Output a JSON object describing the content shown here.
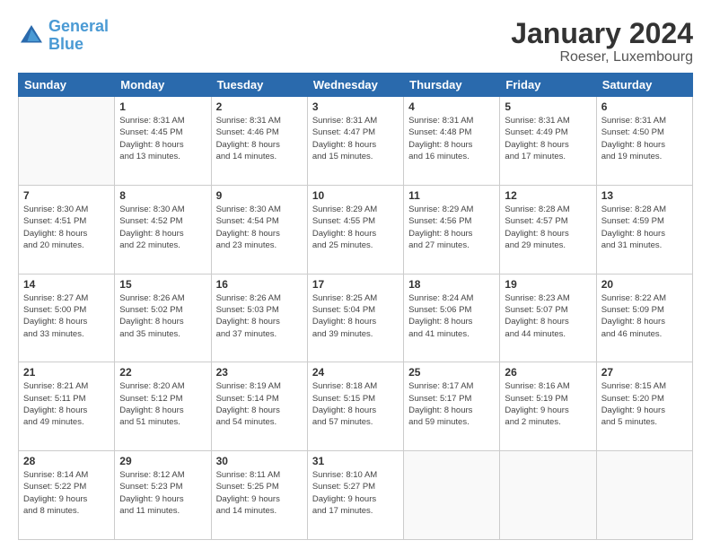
{
  "header": {
    "logo_line1": "General",
    "logo_line2": "Blue",
    "month": "January 2024",
    "location": "Roeser, Luxembourg"
  },
  "days_of_week": [
    "Sunday",
    "Monday",
    "Tuesday",
    "Wednesday",
    "Thursday",
    "Friday",
    "Saturday"
  ],
  "weeks": [
    [
      {
        "day": "",
        "info": ""
      },
      {
        "day": "1",
        "info": "Sunrise: 8:31 AM\nSunset: 4:45 PM\nDaylight: 8 hours\nand 13 minutes."
      },
      {
        "day": "2",
        "info": "Sunrise: 8:31 AM\nSunset: 4:46 PM\nDaylight: 8 hours\nand 14 minutes."
      },
      {
        "day": "3",
        "info": "Sunrise: 8:31 AM\nSunset: 4:47 PM\nDaylight: 8 hours\nand 15 minutes."
      },
      {
        "day": "4",
        "info": "Sunrise: 8:31 AM\nSunset: 4:48 PM\nDaylight: 8 hours\nand 16 minutes."
      },
      {
        "day": "5",
        "info": "Sunrise: 8:31 AM\nSunset: 4:49 PM\nDaylight: 8 hours\nand 17 minutes."
      },
      {
        "day": "6",
        "info": "Sunrise: 8:31 AM\nSunset: 4:50 PM\nDaylight: 8 hours\nand 19 minutes."
      }
    ],
    [
      {
        "day": "7",
        "info": "Sunrise: 8:30 AM\nSunset: 4:51 PM\nDaylight: 8 hours\nand 20 minutes."
      },
      {
        "day": "8",
        "info": "Sunrise: 8:30 AM\nSunset: 4:52 PM\nDaylight: 8 hours\nand 22 minutes."
      },
      {
        "day": "9",
        "info": "Sunrise: 8:30 AM\nSunset: 4:54 PM\nDaylight: 8 hours\nand 23 minutes."
      },
      {
        "day": "10",
        "info": "Sunrise: 8:29 AM\nSunset: 4:55 PM\nDaylight: 8 hours\nand 25 minutes."
      },
      {
        "day": "11",
        "info": "Sunrise: 8:29 AM\nSunset: 4:56 PM\nDaylight: 8 hours\nand 27 minutes."
      },
      {
        "day": "12",
        "info": "Sunrise: 8:28 AM\nSunset: 4:57 PM\nDaylight: 8 hours\nand 29 minutes."
      },
      {
        "day": "13",
        "info": "Sunrise: 8:28 AM\nSunset: 4:59 PM\nDaylight: 8 hours\nand 31 minutes."
      }
    ],
    [
      {
        "day": "14",
        "info": "Sunrise: 8:27 AM\nSunset: 5:00 PM\nDaylight: 8 hours\nand 33 minutes."
      },
      {
        "day": "15",
        "info": "Sunrise: 8:26 AM\nSunset: 5:02 PM\nDaylight: 8 hours\nand 35 minutes."
      },
      {
        "day": "16",
        "info": "Sunrise: 8:26 AM\nSunset: 5:03 PM\nDaylight: 8 hours\nand 37 minutes."
      },
      {
        "day": "17",
        "info": "Sunrise: 8:25 AM\nSunset: 5:04 PM\nDaylight: 8 hours\nand 39 minutes."
      },
      {
        "day": "18",
        "info": "Sunrise: 8:24 AM\nSunset: 5:06 PM\nDaylight: 8 hours\nand 41 minutes."
      },
      {
        "day": "19",
        "info": "Sunrise: 8:23 AM\nSunset: 5:07 PM\nDaylight: 8 hours\nand 44 minutes."
      },
      {
        "day": "20",
        "info": "Sunrise: 8:22 AM\nSunset: 5:09 PM\nDaylight: 8 hours\nand 46 minutes."
      }
    ],
    [
      {
        "day": "21",
        "info": "Sunrise: 8:21 AM\nSunset: 5:11 PM\nDaylight: 8 hours\nand 49 minutes."
      },
      {
        "day": "22",
        "info": "Sunrise: 8:20 AM\nSunset: 5:12 PM\nDaylight: 8 hours\nand 51 minutes."
      },
      {
        "day": "23",
        "info": "Sunrise: 8:19 AM\nSunset: 5:14 PM\nDaylight: 8 hours\nand 54 minutes."
      },
      {
        "day": "24",
        "info": "Sunrise: 8:18 AM\nSunset: 5:15 PM\nDaylight: 8 hours\nand 57 minutes."
      },
      {
        "day": "25",
        "info": "Sunrise: 8:17 AM\nSunset: 5:17 PM\nDaylight: 8 hours\nand 59 minutes."
      },
      {
        "day": "26",
        "info": "Sunrise: 8:16 AM\nSunset: 5:19 PM\nDaylight: 9 hours\nand 2 minutes."
      },
      {
        "day": "27",
        "info": "Sunrise: 8:15 AM\nSunset: 5:20 PM\nDaylight: 9 hours\nand 5 minutes."
      }
    ],
    [
      {
        "day": "28",
        "info": "Sunrise: 8:14 AM\nSunset: 5:22 PM\nDaylight: 9 hours\nand 8 minutes."
      },
      {
        "day": "29",
        "info": "Sunrise: 8:12 AM\nSunset: 5:23 PM\nDaylight: 9 hours\nand 11 minutes."
      },
      {
        "day": "30",
        "info": "Sunrise: 8:11 AM\nSunset: 5:25 PM\nDaylight: 9 hours\nand 14 minutes."
      },
      {
        "day": "31",
        "info": "Sunrise: 8:10 AM\nSunset: 5:27 PM\nDaylight: 9 hours\nand 17 minutes."
      },
      {
        "day": "",
        "info": ""
      },
      {
        "day": "",
        "info": ""
      },
      {
        "day": "",
        "info": ""
      }
    ]
  ]
}
